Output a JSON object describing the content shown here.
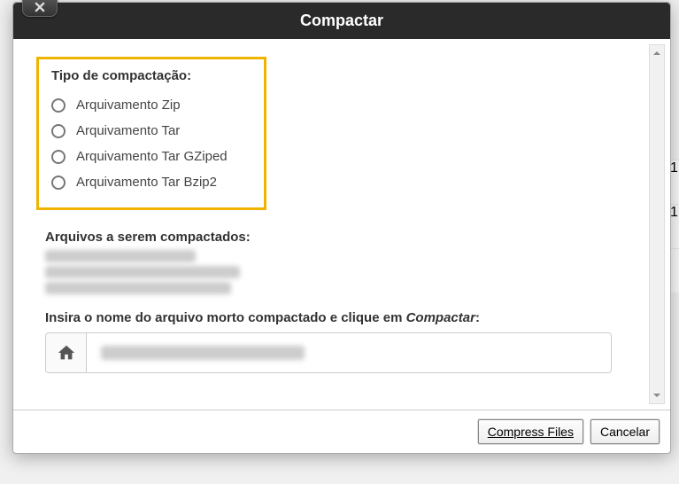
{
  "modal": {
    "title": "Compactar",
    "close_icon": "close-icon"
  },
  "type_section": {
    "label": "Tipo de compactação:",
    "options": [
      {
        "label": "Arquivamento Zip"
      },
      {
        "label": "Arquivamento Tar"
      },
      {
        "label": "Arquivamento Tar GZiped"
      },
      {
        "label": "Arquivamento Tar Bzip2"
      }
    ]
  },
  "files_section": {
    "label": "Arquivos a serem compactados:"
  },
  "name_section": {
    "label_prefix": "Insira o nome do arquivo morto compactado e clique em ",
    "label_em": "Compactar",
    "label_suffix": ":"
  },
  "footer": {
    "compress": "Compress Files",
    "cancel": "Cancelar"
  }
}
